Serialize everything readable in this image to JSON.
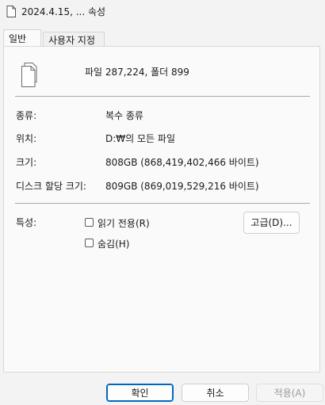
{
  "window": {
    "title": "2024.4.15, ... 속성"
  },
  "tabs": [
    {
      "label": "일반",
      "active": true
    },
    {
      "label": "사용자 지정",
      "active": false
    }
  ],
  "general": {
    "summary": "파일 287,224, 폴더 899",
    "rows": [
      {
        "label": "종류:",
        "value": "복수 종류"
      },
      {
        "label": "위치:",
        "value": "D:₩의 모든 파일"
      },
      {
        "label": "크기:",
        "value": "808GB (868,419,402,466 바이트)"
      },
      {
        "label": "디스크 할당 크기:",
        "value": "809GB (869,019,529,216 바이트)"
      }
    ],
    "attributes_label": "특성:",
    "readonly_label": "읽기 전용(R)",
    "hidden_label": "숨김(H)",
    "advanced_label": "고급(D)..."
  },
  "buttons": {
    "ok": "확인",
    "cancel": "취소",
    "apply": "적용(A)"
  }
}
